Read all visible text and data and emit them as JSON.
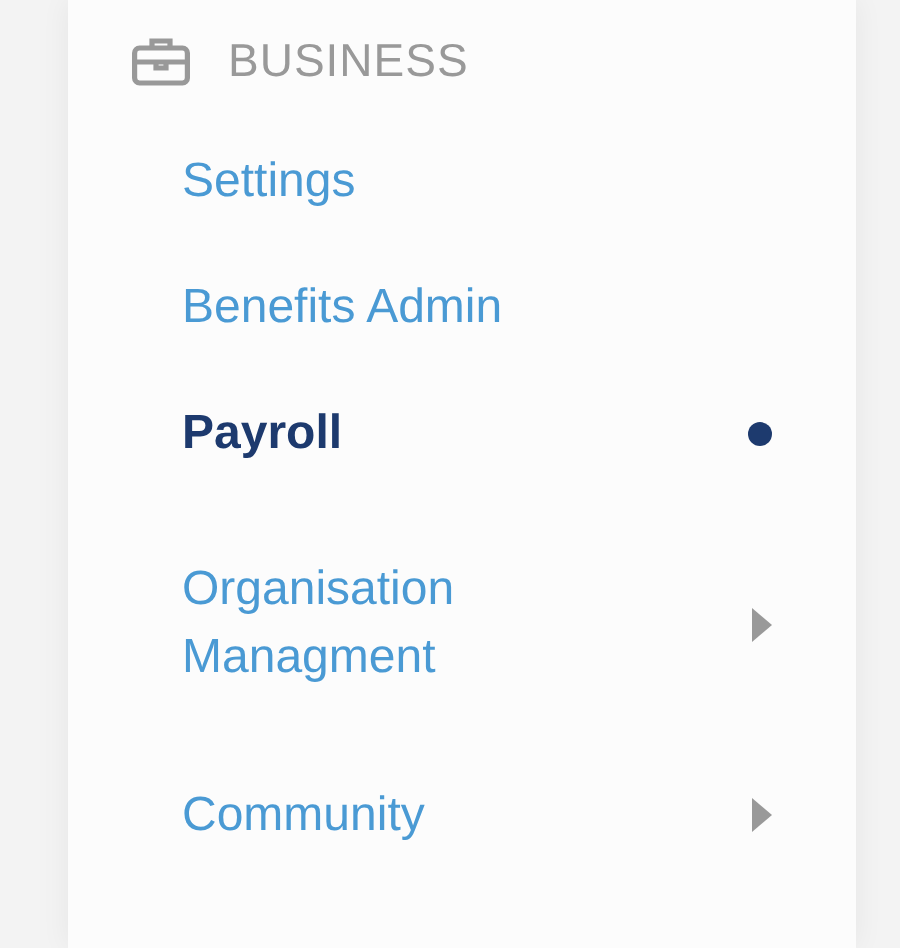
{
  "section": {
    "title": "BUSINESS"
  },
  "items": [
    {
      "label": "Settings",
      "selected": false,
      "expandable": false
    },
    {
      "label": "Benefits Admin",
      "selected": false,
      "expandable": false
    },
    {
      "label": "Payroll",
      "selected": true,
      "expandable": false
    },
    {
      "label": "Organisation Managment",
      "selected": false,
      "expandable": true
    },
    {
      "label": "Community",
      "selected": false,
      "expandable": true
    }
  ]
}
